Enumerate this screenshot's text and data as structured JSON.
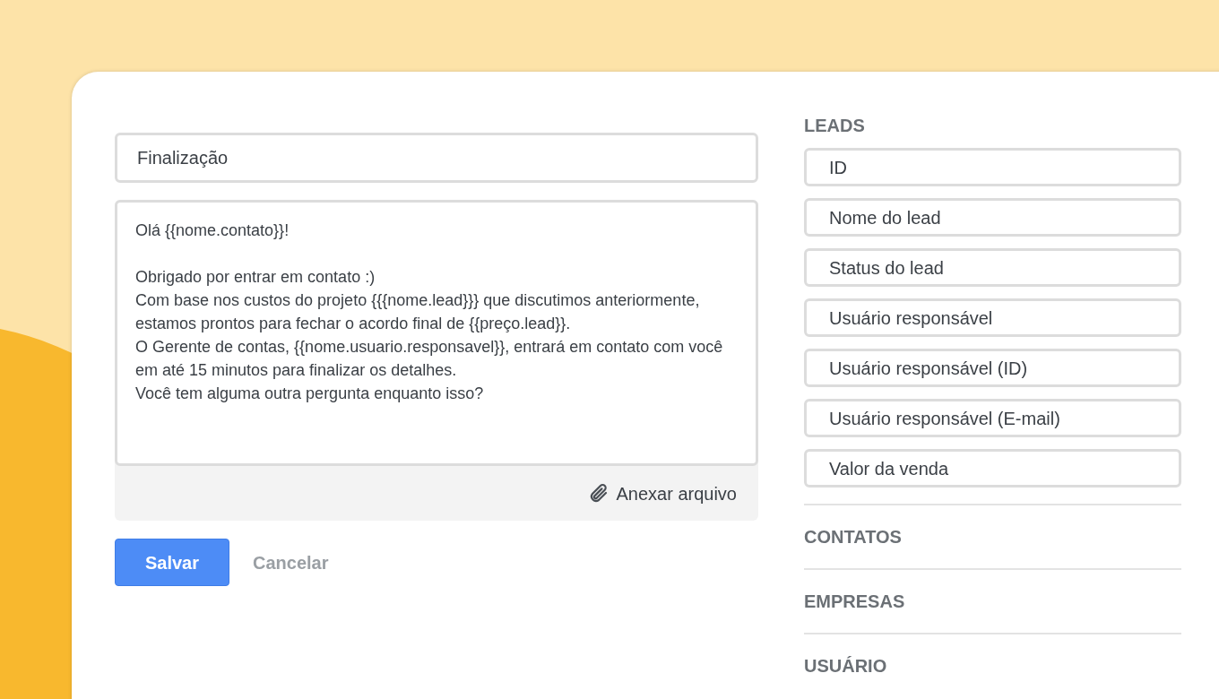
{
  "template": {
    "title": "Finalização",
    "message": "Olá {{nome.contato}}!\n\nObrigado por entrar em contato :)\nCom base nos custos do projeto {{{nome.lead}}} que discutimos anteriormente, estamos prontos para fechar o acordo final de {{preço.lead}}.\nO Gerente de contas, {{nome.usuario.responsavel}}, entrará em contato com você em até 15 minutos para finalizar os detalhes.\nVocê tem alguma outra pergunta enquanto isso?",
    "attach": "Anexar arquivo"
  },
  "buttons": [
    {
      "kind": "primary",
      "label": "Salvar"
    },
    {
      "kind": "secondary",
      "label": "Cancelar"
    }
  ],
  "sections": [
    {
      "title": "LEADS",
      "items": [
        "ID",
        "Nome do lead",
        "Status do lead",
        "Usuário responsável",
        "Usuário responsável (ID)",
        "Usuário responsável (E-mail)",
        "Valor da venda"
      ]
    },
    {
      "title": "CONTATOS"
    },
    {
      "title": "EMPRESAS"
    },
    {
      "title": "USUÁRIO"
    }
  ]
}
